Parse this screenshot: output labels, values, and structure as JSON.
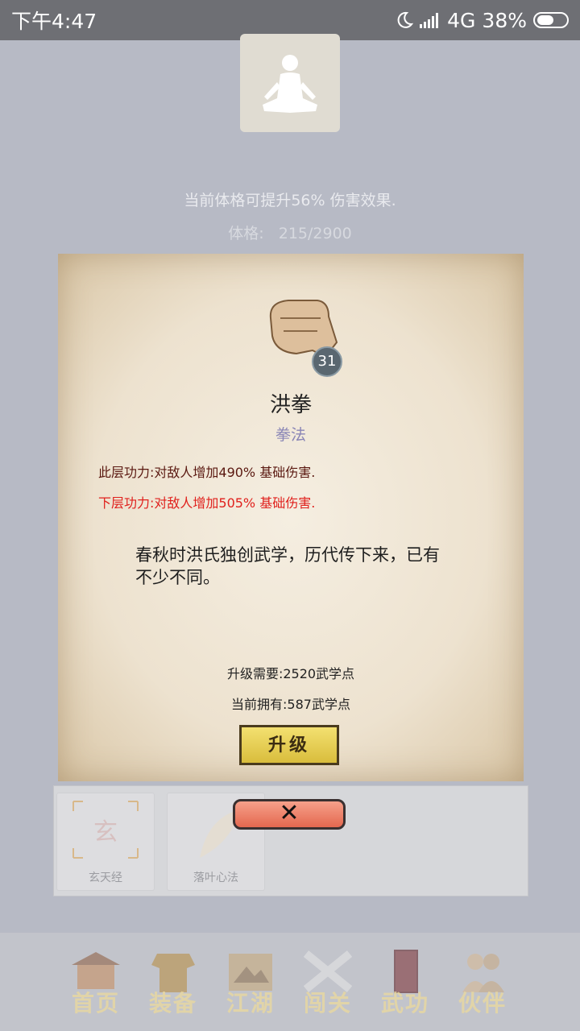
{
  "status_bar": {
    "time": "下午4:47",
    "network": "4G",
    "battery": "38%"
  },
  "header": {
    "info_text": "当前体格可提升56% 伤害效果.",
    "stat_label": "体格:",
    "stat_value": "215/2900"
  },
  "dialog": {
    "skill_level": "31",
    "skill_name": "洪拳",
    "skill_type": "拳法",
    "current_effect": "此层功力:对敌人增加490% 基础伤害.",
    "next_effect": "下层功力:对敌人增加505% 基础伤害.",
    "description": "春秋时洪氏独创武学，历代传下来，已有不少不同。",
    "upgrade_need": "升级需要:2520武学点",
    "current_have": "当前拥有:587武学点",
    "upgrade_button": "升级"
  },
  "skill_list": [
    {
      "name": "玄天经",
      "icon": "xuan-glyph-icon"
    },
    {
      "name": "落叶心法",
      "icon": "leaf-icon"
    }
  ],
  "bottom_nav": [
    {
      "label": "首页",
      "icon": "home-pavilion-icon"
    },
    {
      "label": "装备",
      "icon": "armor-icon"
    },
    {
      "label": "江湖",
      "icon": "map-scroll-icon"
    },
    {
      "label": "闯关",
      "icon": "crossed-swords-icon"
    },
    {
      "label": "武功",
      "icon": "martial-book-icon"
    },
    {
      "label": "伙伴",
      "icon": "partners-icon"
    }
  ],
  "colors": {
    "current_effect": "#5a1810",
    "next_effect": "#e0201c",
    "skill_type": "#8a86b6",
    "upgrade_bg": "#e8cf52",
    "close_bg": "#ec7a60"
  }
}
